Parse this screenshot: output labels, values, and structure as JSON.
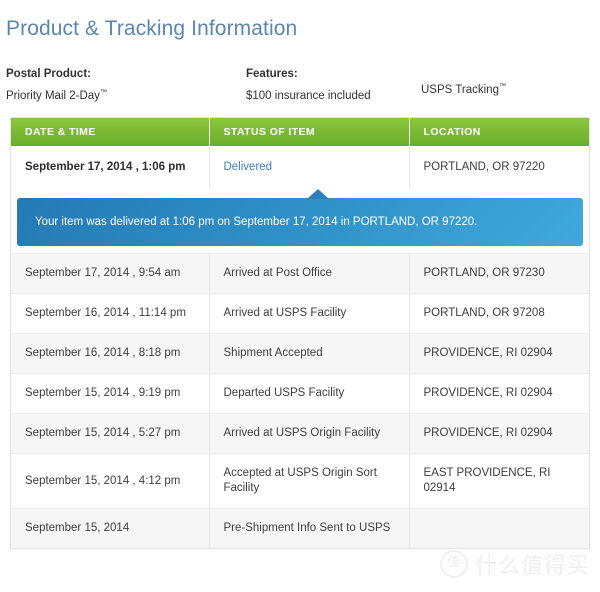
{
  "page": {
    "title": "Product & Tracking Information"
  },
  "summary": {
    "postal_product_label": "Postal Product:",
    "postal_product_value": "Priority Mail 2-Day",
    "postal_product_tm": "™",
    "features_label": "Features:",
    "features_value": "$100 insurance included",
    "tracking_value": "USPS Tracking",
    "tracking_tm": "™"
  },
  "table": {
    "columns": [
      "DATE & TIME",
      "STATUS OF ITEM",
      "LOCATION"
    ],
    "current_event": {
      "datetime": "September 17, 2014 , 1:06 pm",
      "status": "Delivered",
      "location": "PORTLAND, OR 97220"
    },
    "banner": {
      "text": "Your item was delivered at 1:06 pm on September 17, 2014 in PORTLAND, OR 97220."
    },
    "events": [
      {
        "datetime": "September 17, 2014 , 9:54 am",
        "status": "Arrived at Post Office",
        "location": "PORTLAND, OR 97230"
      },
      {
        "datetime": "September 16, 2014 , 11:14 pm",
        "status": "Arrived at USPS Facility",
        "location": "PORTLAND, OR 97208"
      },
      {
        "datetime": "September 16, 2014 , 8:18 pm",
        "status": "Shipment Accepted",
        "location": "PROVIDENCE, RI 02904"
      },
      {
        "datetime": "September 15, 2014 , 9:19 pm",
        "status": "Departed USPS Facility",
        "location": "PROVIDENCE, RI 02904"
      },
      {
        "datetime": "September 15, 2014 , 5:27 pm",
        "status": "Arrived at USPS Origin Facility",
        "location": "PROVIDENCE, RI 02904"
      },
      {
        "datetime": "September 15, 2014 , 4:12 pm",
        "status": "Accepted at USPS Origin Sort Facility",
        "location": "EAST PROVIDENCE, RI 02914"
      },
      {
        "datetime": "September 15, 2014",
        "status": "Pre-Shipment Info Sent to USPS",
        "location": ""
      }
    ]
  },
  "watermark": {
    "badge": "值",
    "text": "什么值得买"
  },
  "colors": {
    "title": "#5b86b2",
    "header_green_top": "#8cc63e",
    "header_green_bottom": "#6aad2b",
    "banner_blue_dark": "#2579b5",
    "banner_blue_light": "#3fa9dd",
    "status_link": "#3f7fbf",
    "row_alt": "#f6f6f6"
  }
}
